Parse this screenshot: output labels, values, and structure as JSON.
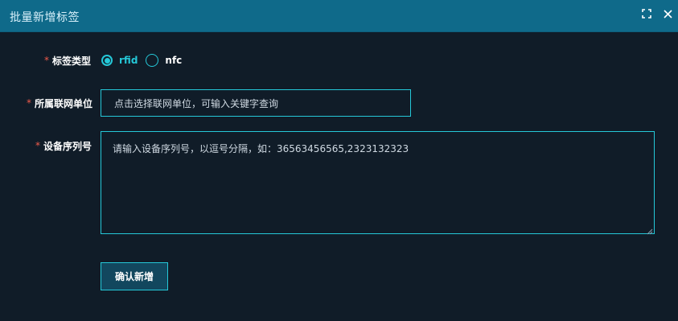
{
  "dialog": {
    "title": "批量新增标签",
    "icons": {
      "fullscreen": "fullscreen-icon",
      "close": "close-icon"
    }
  },
  "form": {
    "required_mark": "*",
    "tag_type": {
      "label": "标签类型",
      "options": [
        {
          "label": "rfid",
          "checked": true
        },
        {
          "label": "nfc",
          "checked": false
        }
      ]
    },
    "network_unit": {
      "label": "所属联网单位",
      "placeholder": "点击选择联网单位，可输入关键字查询"
    },
    "serial_numbers": {
      "label": "设备序列号",
      "placeholder": "请输入设备序列号，以逗号分隔，如：36563456565,2323132323"
    },
    "submit_label": "确认新增"
  },
  "colors": {
    "titlebar": "#0f6a8a",
    "background": "#101c28",
    "accent": "#25c8d8",
    "required": "#f05b4b",
    "button_bg": "#12475e"
  }
}
